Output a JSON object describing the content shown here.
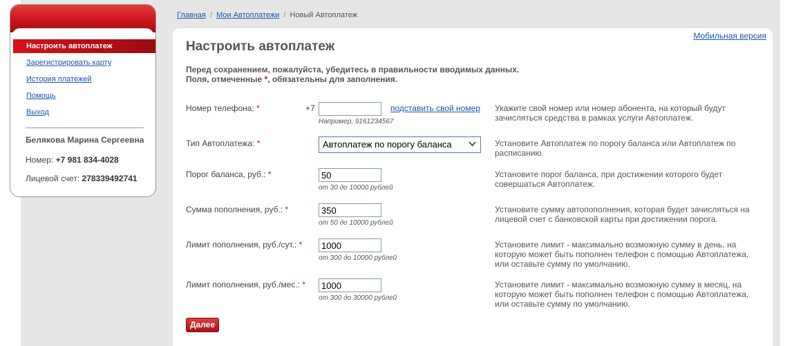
{
  "sidebar": {
    "items": [
      {
        "label": "Настроить автоплатеж"
      },
      {
        "label": "Зарегистрировать карту"
      },
      {
        "label": "История платежей"
      },
      {
        "label": "Помощь"
      },
      {
        "label": "Выход"
      }
    ],
    "user_name": "Белякова Марина Сергеевна",
    "number_label": "Номер:",
    "number_value": "+7 981 834-4028",
    "account_label": "Лицевой счет:",
    "account_value": "278339492741"
  },
  "breadcrumb": {
    "home": "Главная",
    "autopayments": "Мои Автоплатежи",
    "current": "Новый Автоплатеж",
    "separator": "/"
  },
  "mobile_link": "Мобильная версия",
  "page_title": "Настроить автоплатеж",
  "notice": {
    "line1": "Перед сохранением, пожалуйста, убедитесь в правильности вводимых данных.",
    "line2_a": "Поля, отмеченные ",
    "line2_star": "*",
    "line2_b": ", обязательны для заполнения."
  },
  "form": {
    "phone": {
      "label": "Номер телефона:",
      "star": "*",
      "prefix": "+7",
      "value": "",
      "hint": "Например, 9161234567",
      "helper_link": "подставить свой номер",
      "desc": "Укажите свой номер или номер абонента, на который будут зачисляться средства в рамках услуги Автоплатеж."
    },
    "type": {
      "label": "Тип Автоплатежа:",
      "star": "*",
      "selected": "Автоплатеж по порогу баланса",
      "desc": "Установите Автоплатеж по порогу баланса или Автоплатеж по расписанию."
    },
    "threshold": {
      "label": "Порог баланса, руб.:",
      "star": "*",
      "value": "50",
      "hint": "от 30 до 10000 рублей",
      "desc": "Установите порог баланса, при достижении которого будет совершаться Автоплатеж."
    },
    "amount": {
      "label": "Сумма пополнения, руб.:",
      "star": "*",
      "value": "350",
      "hint": "от 50 до 10000 рублей",
      "desc": "Установите сумму автопополнения, которая будет зачисляться на лицевой счет с банковской карты при достижении порога."
    },
    "daily_limit": {
      "label": "Лимит пополнения, руб./сут.:",
      "star": "*",
      "value": "1000",
      "hint": "от 300 до 10000 рублей",
      "desc": "Установите лимит - максимально возможную сумму в день, на которую может быть пополнен телефон с помощью Автоплатежа, или оставьте сумму по умолчанию."
    },
    "monthly_limit": {
      "label": "Лимит пополнения, руб./мес.:",
      "star": "*",
      "value": "1000",
      "hint": "от 300 до 30000 рублей",
      "desc": "Установите лимит - максимально возможную сумму в месяц, на которую может быть пополнен телефон с помощью Автоплатежа, или оставьте сумму по умолчанию."
    }
  },
  "next_button": "Далее",
  "colors": {
    "brand_red": "#c8141b",
    "link_blue": "#1a56a8",
    "required_red": "#dd0000"
  }
}
